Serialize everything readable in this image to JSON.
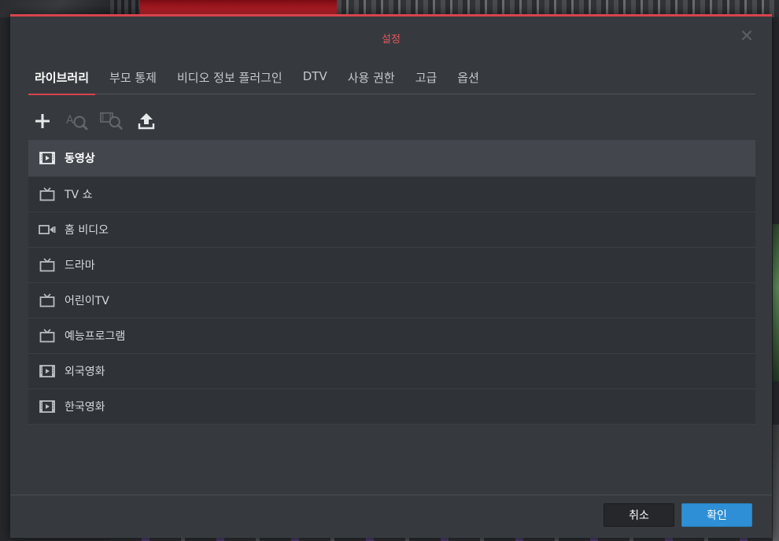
{
  "dialog": {
    "title": "설정",
    "close_icon": "close-icon"
  },
  "tabs": [
    {
      "label": "라이브러리",
      "active": true
    },
    {
      "label": "부모 통제",
      "active": false
    },
    {
      "label": "비디오 정보 플러그인",
      "active": false
    },
    {
      "label": "DTV",
      "active": false
    },
    {
      "label": "사용 권한",
      "active": false
    },
    {
      "label": "고급",
      "active": false
    },
    {
      "label": "옵션",
      "active": false
    }
  ],
  "toolbar": {
    "items": [
      {
        "icon": "plus-icon",
        "enabled": true
      },
      {
        "icon": "search-text-icon",
        "enabled": false
      },
      {
        "icon": "search-film-icon",
        "enabled": false
      },
      {
        "icon": "upload-icon",
        "enabled": true
      }
    ]
  },
  "libraries": [
    {
      "label": "동영상",
      "icon": "film-icon",
      "selected": true
    },
    {
      "label": "TV 쇼",
      "icon": "tv-icon",
      "selected": false
    },
    {
      "label": "홈 비디오",
      "icon": "camcorder-icon",
      "selected": false
    },
    {
      "label": "드라마",
      "icon": "tv-icon",
      "selected": false
    },
    {
      "label": "어린이TV",
      "icon": "tv-icon",
      "selected": false
    },
    {
      "label": "예능프로그램",
      "icon": "tv-icon",
      "selected": false
    },
    {
      "label": "외국영화",
      "icon": "film-icon",
      "selected": false
    },
    {
      "label": "한국영화",
      "icon": "film-icon",
      "selected": false
    }
  ],
  "footer": {
    "cancel_label": "취소",
    "ok_label": "확인"
  },
  "colors": {
    "accent": "#d9444d",
    "primary_button": "#2f8fd6",
    "dialog_bg": "#363a3e"
  }
}
